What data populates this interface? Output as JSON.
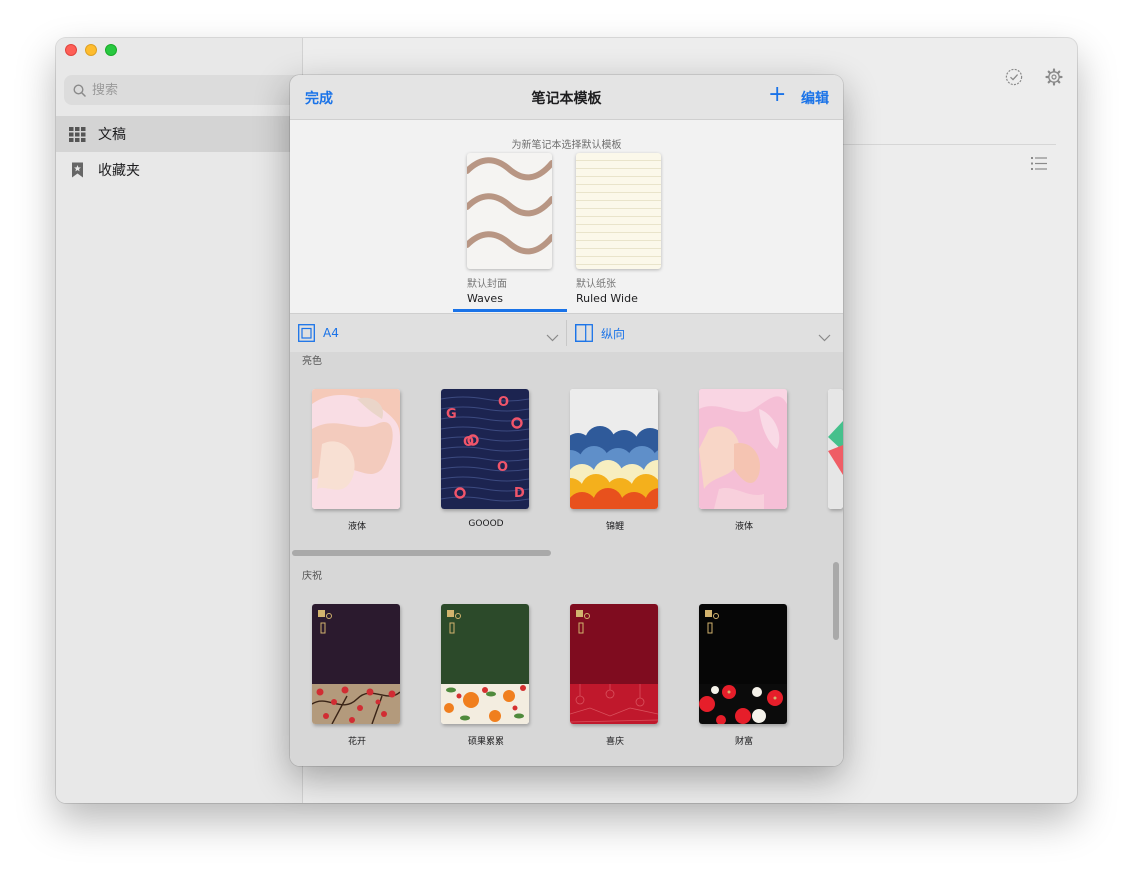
{
  "sidebar": {
    "search_placeholder": "搜索",
    "items": [
      {
        "label": "文稿",
        "icon": "grid-icon",
        "selected": true
      },
      {
        "label": "收藏夹",
        "icon": "bookmark-icon",
        "selected": false
      }
    ]
  },
  "toolbar": {
    "icons": [
      "checkmark-circle-icon",
      "gear-icon",
      "list-icon"
    ]
  },
  "modal": {
    "done_label": "完成",
    "title": "笔记本模板",
    "add_label": "+",
    "edit_label": "编辑",
    "subtitle": "为新笔记本选择默认模板",
    "cover": {
      "caption": "默认封面",
      "name": "Waves"
    },
    "paper": {
      "caption": "默认纸张",
      "name": "Ruled Wide"
    },
    "size_dropdown": "A4",
    "orientation_dropdown": "纵向",
    "sections": [
      {
        "title": "亮色",
        "items": [
          {
            "label": "液体"
          },
          {
            "label": "GOOOD"
          },
          {
            "label": "锦鲤"
          },
          {
            "label": "液体"
          }
        ]
      },
      {
        "title": "庆祝",
        "items": [
          {
            "label": "花开"
          },
          {
            "label": "硕果累累"
          },
          {
            "label": "喜庆"
          },
          {
            "label": "财富"
          }
        ]
      }
    ],
    "goood_letters": [
      "G",
      "O",
      "O",
      "O",
      "D"
    ]
  },
  "colors": {
    "accent": "#1a73e8",
    "wave_stroke": "#b89684"
  }
}
